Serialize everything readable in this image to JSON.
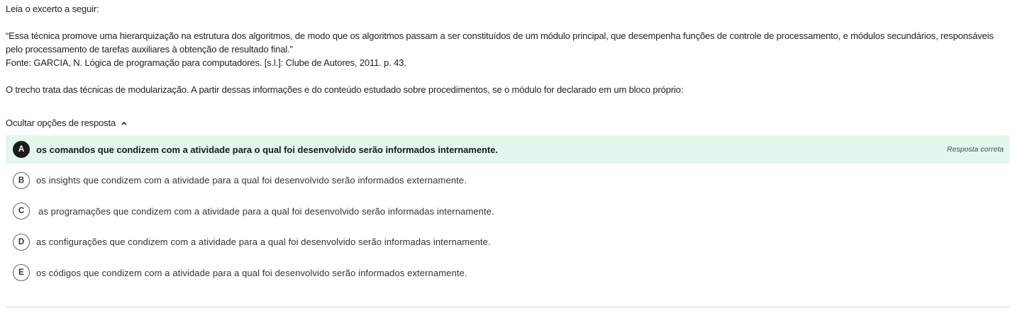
{
  "question": {
    "intro": "Leia o excerto a seguir:",
    "quote": "“Essa técnica promove uma hierarquização na estrutura dos algoritmos, de modo que os algoritmos passam a ser constituídos de um módulo principal, que desempenha funções de controle de processamento, e módulos secundários, responsáveis pelo processamento de tarefas auxiliares à obtenção de resultado final.”",
    "source": "Fonte: GARCIA, N. Lógica de programação para computadores. [s.l.]: Clube de Autores, 2011. p. 43.",
    "prompt": "O trecho trata das técnicas de modularização. A partir dessas informações e do conteúdo estudado sobre procedimentos, se o módulo for declarado em um bloco próprio:"
  },
  "toggle": {
    "label": "Ocultar opções de resposta",
    "icon": "chevron-up-icon"
  },
  "options": [
    {
      "letter": "A",
      "text": "os comandos que condizem com a atividade para o qual foi desenvolvido serão informados internamente.",
      "correct": true,
      "badge": "Resposta correta"
    },
    {
      "letter": "B",
      "text": "os insights que condizem com a atividade para a qual foi desenvolvido serão informados externamente.",
      "correct": false
    },
    {
      "letter": "C",
      "text": "as programações que condizem com a atividade para a qual foi desenvolvido serão informadas internamente.",
      "correct": false
    },
    {
      "letter": "D",
      "text": "as configurações que condizem com a atividade para a qual foi desenvolvido serão informadas internamente.",
      "correct": false
    },
    {
      "letter": "E",
      "text": "os códigos que condizem com a atividade para a qual foi desenvolvido serão informados externamente.",
      "correct": false
    }
  ],
  "colors": {
    "correct_background": "#e3f8ec",
    "selected_letter_background": "#1c1c1c"
  }
}
